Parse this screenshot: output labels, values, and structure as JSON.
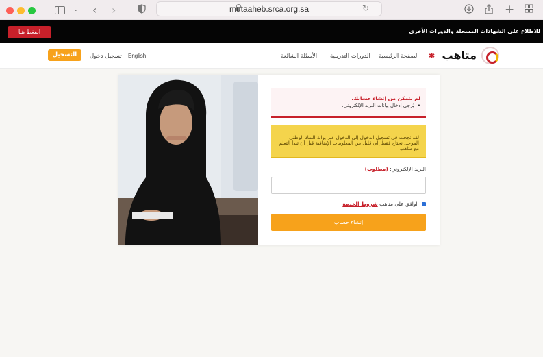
{
  "browser": {
    "url": "mutaaheb.srca.org.sa"
  },
  "banner": {
    "text": "للاطلاع على الشهادات المسجلة والدورات الأخرى",
    "button_label": "اضغط هنا"
  },
  "nav": {
    "brand": "متاهب",
    "items": [
      {
        "label": "الصفحة الرئيسية"
      },
      {
        "label": "الدورات التدريبية"
      },
      {
        "label": "الأسئلة الشائعة"
      }
    ],
    "language": "English",
    "login": "تسجيل دخول",
    "register": "التسجيل"
  },
  "form": {
    "error_title": "لم نتمكن من إنشاء حسابك.",
    "error_item": "يُرجى إدخال بيانات البريد الإلكتروني.",
    "warning": "لقد نجحت في تسجيل الدخول إلى الدخول عبر بوابة النفاذ الوطني الموحد. نحتاج فقط إلى قليل من المعلومات الإضافية قبل أن تبدأ التعلم مع متاهب.",
    "email_label": "البريد الإلكتروني:",
    "email_required": "(مطلوب)",
    "email_value": "",
    "terms_prefix": "اوافق على متاهب",
    "terms_link": "شروط الخدمة",
    "submit": "إنشاء حساب"
  },
  "colors": {
    "brand_red": "#c7202a",
    "accent_orange": "#f7a21b",
    "warning_yellow": "#f4d44c"
  }
}
